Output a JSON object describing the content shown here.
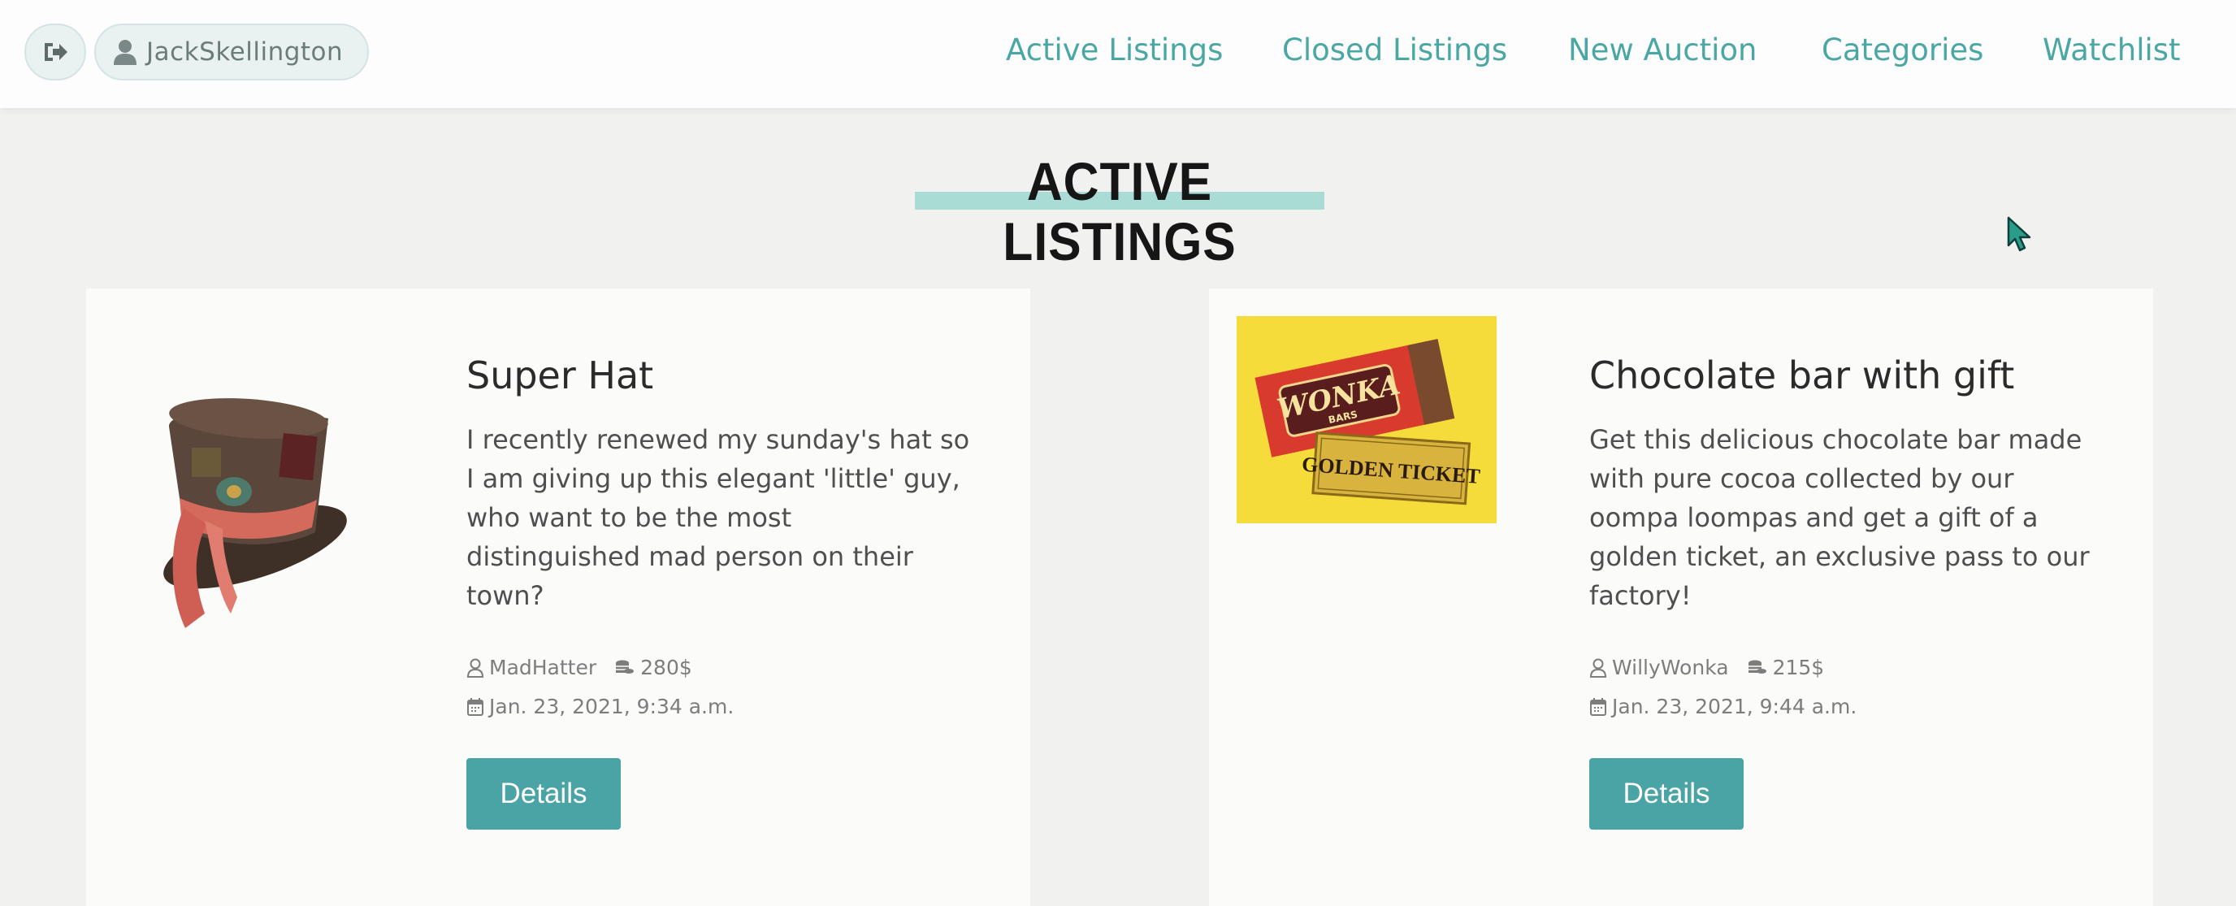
{
  "nav": {
    "username": "JackSkellington",
    "links": [
      "Active Listings",
      "Closed Listings",
      "New Auction",
      "Categories",
      "Watchlist"
    ]
  },
  "page": {
    "title": "ACTIVE LISTINGS"
  },
  "listings": [
    {
      "title": "Super Hat",
      "description": "I recently renewed my sunday's hat so I am giving up this elegant 'little' guy, who want to be the most distinguished mad person on their town?",
      "seller": "MadHatter",
      "price": "280$",
      "date": "Jan. 23, 2021, 9:34 a.m.",
      "button": "Details"
    },
    {
      "title": "Chocolate bar with gift",
      "description": "Get this delicious chocolate bar made with pure cocoa collected by our oompa loompas and get a gift of a golden ticket, an exclusive pass to our factory!",
      "seller": "WillyWonka",
      "price": "215$",
      "date": "Jan. 23, 2021, 9:44 a.m.",
      "button": "Details",
      "image_text": {
        "brand": "WONKA",
        "brand_sub": "BARS",
        "ticket": "GOLDEN TICKET"
      }
    }
  ],
  "colors": {
    "accent": "#4aa7a3",
    "button": "#4aa3a4",
    "title_highlight": "#a9dcd5"
  },
  "icons": {
    "logout": "sign-out-icon",
    "user": "user-icon",
    "seller": "user-outline-icon",
    "price": "coins-icon",
    "date": "calendar-icon"
  }
}
